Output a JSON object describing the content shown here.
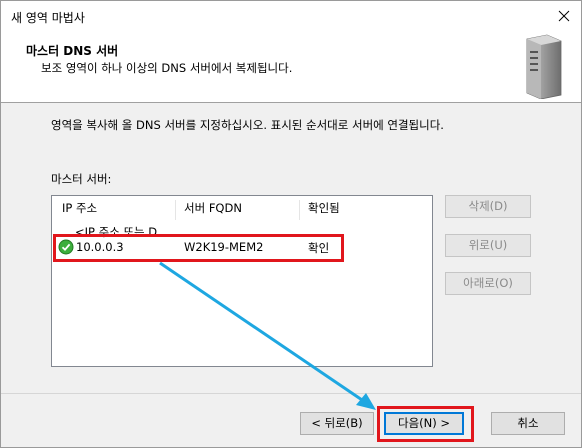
{
  "window": {
    "title": "새 영역 마법사"
  },
  "header": {
    "title": "마스터 DNS 서버",
    "subtitle": "보조 영역이 하나 이상의 DNS 서버에서 복제됩니다."
  },
  "body": {
    "intro": "영역을 복사해 올 DNS 서버를 지정하십시오. 표시된 순서대로 서버에 연결됩니다.",
    "list_label": "마스터 서버:"
  },
  "list": {
    "columns": [
      "IP 주소",
      "서버 FQDN",
      "확인됨"
    ],
    "placeholder": "<IP 주소 또는 D...",
    "rows": [
      {
        "ip": "10.0.0.3",
        "fqdn": "W2K19-MEM2",
        "validated": "확인",
        "status_icon": "check-ok-icon"
      }
    ]
  },
  "side_buttons": {
    "delete": "삭제(D)",
    "up": "위로(U)",
    "down": "아래로(O)"
  },
  "footer": {
    "back": "< 뒤로(B)",
    "next": "다음(N) >",
    "cancel": "취소"
  },
  "colors": {
    "highlight": "#e1161c",
    "arrow": "#1ea7e1",
    "accent": "#0078d7"
  }
}
